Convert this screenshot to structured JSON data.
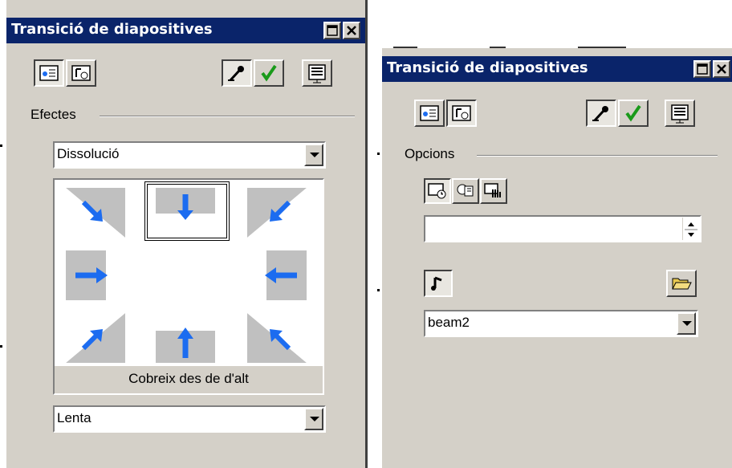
{
  "left_panel": {
    "title": "Transició de diapositives",
    "group_label": "Efectes",
    "effect_value": "Dissolució",
    "effect_caption": "Cobreix des de d'alt",
    "speed_value": "Lenta",
    "icons": [
      "effects-tab-icon",
      "options-tab-icon",
      "record-narration-icon",
      "apply-check-icon",
      "slideshow-icon",
      "minimize-icon",
      "close-icon"
    ]
  },
  "right_panel": {
    "title": "Transició de diapositives",
    "group_label": "Opcions",
    "timing_value": "",
    "sound_value": "beam2",
    "icons": [
      "advance-on-time-icon",
      "advance-on-click-icon",
      "advance-on-click-or-time-icon",
      "sound-note-icon",
      "open-folder-icon"
    ]
  },
  "colors": {
    "titlebar": "#0a246a",
    "face": "#d4d0c8",
    "arrow_blue": "#1c6cf0",
    "check_green": "#1a9a1a"
  }
}
